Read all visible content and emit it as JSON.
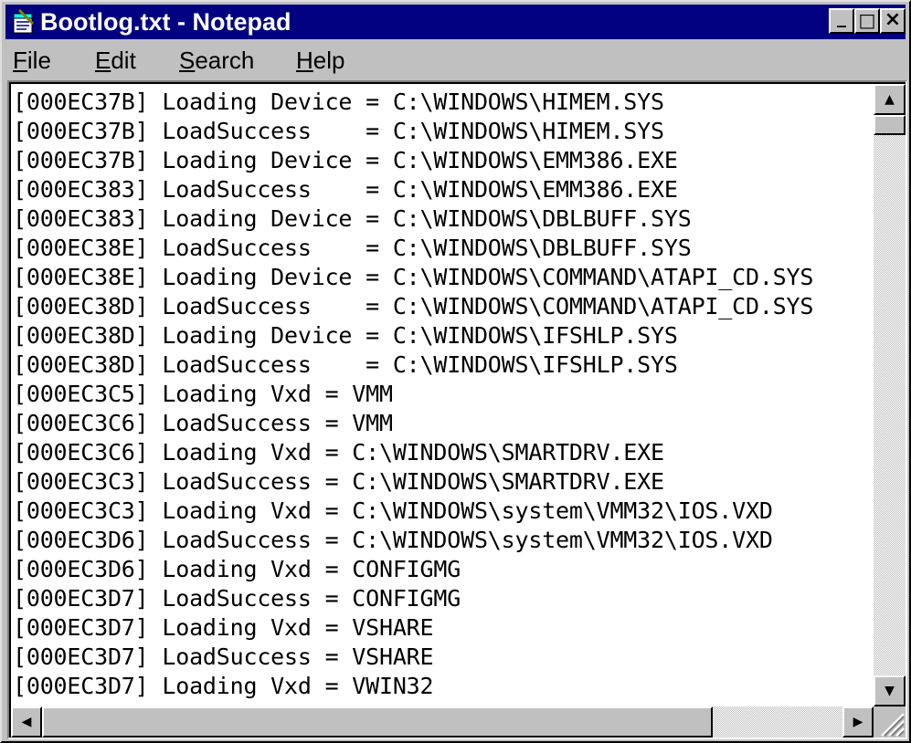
{
  "window": {
    "title": "Bootlog.txt - Notepad",
    "controls": {
      "minimize": "_",
      "maximize": "□",
      "close": "×"
    }
  },
  "menu": {
    "items": [
      {
        "label": "File",
        "accel": "F",
        "rest": "ile"
      },
      {
        "label": "Edit",
        "accel": "E",
        "rest": "dit"
      },
      {
        "label": "Search",
        "accel": "S",
        "rest": "earch"
      },
      {
        "label": "Help",
        "accel": "H",
        "rest": "elp"
      }
    ]
  },
  "document": {
    "lines": [
      "[000EC37B] Loading Device = C:\\WINDOWS\\HIMEM.SYS",
      "[000EC37B] LoadSuccess    = C:\\WINDOWS\\HIMEM.SYS",
      "[000EC37B] Loading Device = C:\\WINDOWS\\EMM386.EXE",
      "[000EC383] LoadSuccess    = C:\\WINDOWS\\EMM386.EXE",
      "[000EC383] Loading Device = C:\\WINDOWS\\DBLBUFF.SYS",
      "[000EC38E] LoadSuccess    = C:\\WINDOWS\\DBLBUFF.SYS",
      "[000EC38E] Loading Device = C:\\WINDOWS\\COMMAND\\ATAPI_CD.SYS",
      "[000EC38D] LoadSuccess    = C:\\WINDOWS\\COMMAND\\ATAPI_CD.SYS",
      "[000EC38D] Loading Device = C:\\WINDOWS\\IFSHLP.SYS",
      "[000EC38D] LoadSuccess    = C:\\WINDOWS\\IFSHLP.SYS",
      "[000EC3C5] Loading Vxd = VMM",
      "[000EC3C6] LoadSuccess = VMM",
      "[000EC3C6] Loading Vxd = C:\\WINDOWS\\SMARTDRV.EXE",
      "[000EC3C3] LoadSuccess = C:\\WINDOWS\\SMARTDRV.EXE",
      "[000EC3C3] Loading Vxd = C:\\WINDOWS\\system\\VMM32\\IOS.VXD",
      "[000EC3D6] LoadSuccess = C:\\WINDOWS\\system\\VMM32\\IOS.VXD",
      "[000EC3D6] Loading Vxd = CONFIGMG",
      "[000EC3D7] LoadSuccess = CONFIGMG",
      "[000EC3D7] Loading Vxd = VSHARE",
      "[000EC3D7] LoadSuccess = VSHARE",
      "[000EC3D7] Loading Vxd = VWIN32"
    ]
  },
  "scrollbars": {
    "up_arrow": "▲",
    "down_arrow": "▼",
    "left_arrow": "◀",
    "right_arrow": "▶"
  },
  "colors": {
    "titlebar": "#000080",
    "face": "#c0c0c0"
  }
}
